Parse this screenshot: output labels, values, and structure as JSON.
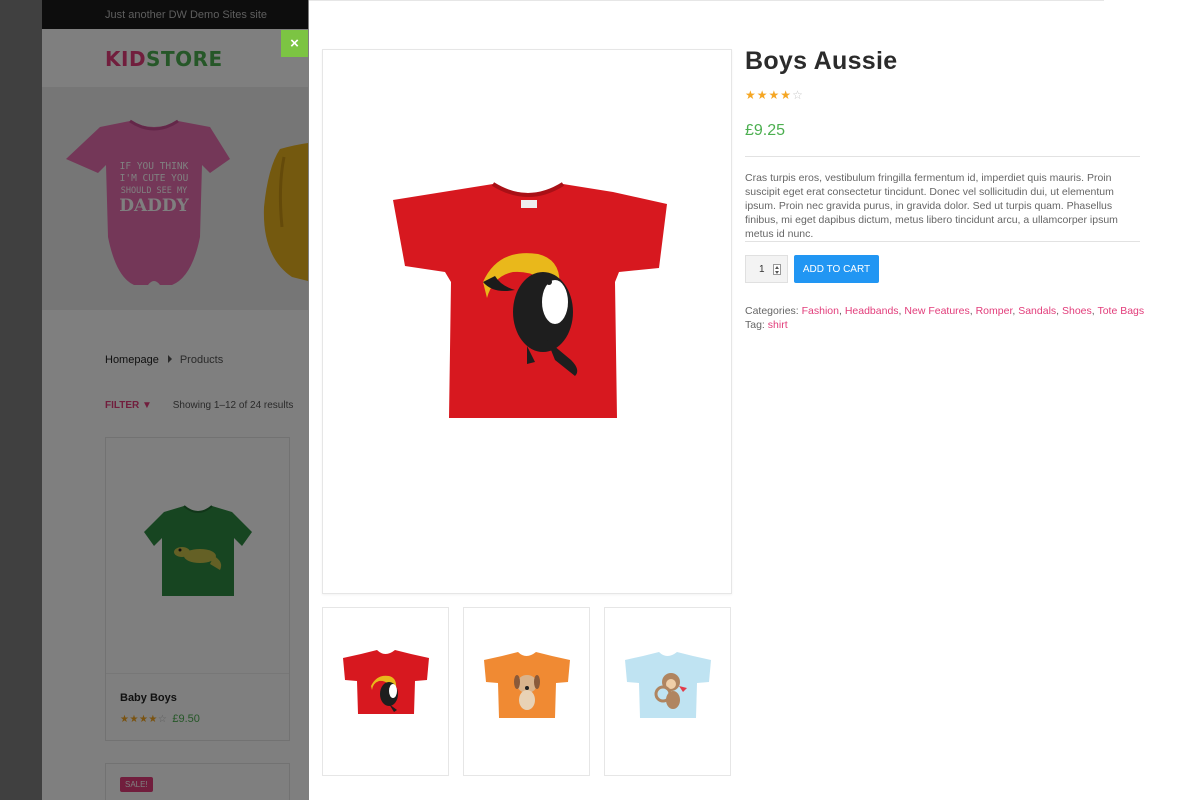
{
  "site": {
    "tagline": "Just another DW Demo Sites site",
    "logo_part1": "KID",
    "logo_part2": "STORE",
    "hero_text": "IF YOU THINK I'M CUTE YOU SHOULD SEE MY DADDY"
  },
  "breadcrumb": {
    "home": "Homepage",
    "current": "Products"
  },
  "listing": {
    "filter_label": "FILTER",
    "result_count": "Showing 1–12 of 24 results"
  },
  "cards": [
    {
      "name": "Baby Boys",
      "rating": 4,
      "price": "£9.50"
    },
    {
      "badge": "SALE!"
    }
  ],
  "close_label": "×",
  "product": {
    "title": "Boys Aussie",
    "rating": 4,
    "price": "£9.25",
    "description": "Cras turpis eros, vestibulum fringilla fermentum id, imperdiet quis mauris. Proin suscipit eget erat consectetur tincidunt. Donec vel sollicitudin dui, ut elementum ipsum. Proin nec gravida purus, in gravida dolor. Sed ut turpis quam. Phasellus finibus, mi eget dapibus dictum, metus libero tincidunt arcu, a ullamcorper ipsum metus id nunc.",
    "quantity": "1",
    "add_to_cart": "ADD TO CART",
    "categories_label": "Categories:",
    "categories": [
      "Fashion",
      "Headbands",
      "New Features",
      "Romper",
      "Sandals",
      "Shoes",
      "Tote Bags"
    ],
    "tag_label": "Tag:",
    "tag": "shirt",
    "thumbnails": [
      {
        "name": "red-tshirt-toucan",
        "color": "#d7181f"
      },
      {
        "name": "orange-tshirt-dog",
        "color": "#f08a33"
      },
      {
        "name": "lightblue-tshirt-monkey",
        "color": "#bfe3f2"
      }
    ]
  },
  "colors": {
    "accent_pink": "#e23c7a",
    "accent_green": "#4caf50",
    "button_blue": "#2196f3",
    "close_green": "#7cc443"
  }
}
